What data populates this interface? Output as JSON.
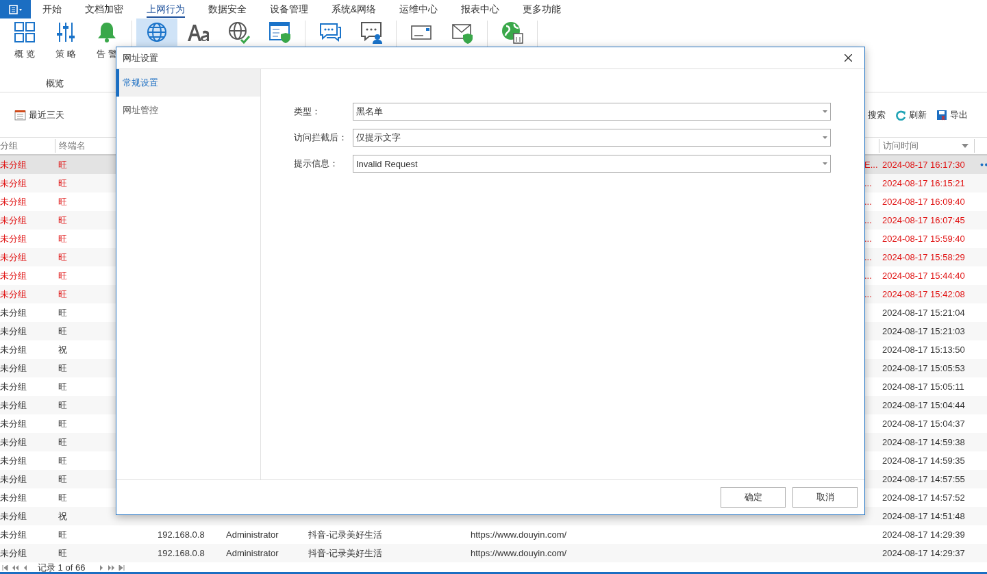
{
  "menu": {
    "tabs": [
      {
        "label": "开始",
        "selected": false
      },
      {
        "label": "文档加密",
        "selected": false
      },
      {
        "label": "上网行为",
        "selected": true
      },
      {
        "label": "数据安全",
        "selected": false
      },
      {
        "label": "设备管理",
        "selected": false
      },
      {
        "label": "系统&网络",
        "selected": false
      },
      {
        "label": "运维中心",
        "selected": false
      },
      {
        "label": "报表中心",
        "selected": false
      },
      {
        "label": "更多功能",
        "selected": false
      }
    ]
  },
  "ribbon": {
    "group_label": "概览",
    "buttons": [
      {
        "kind": "grid",
        "label": "概 览",
        "selected": false
      },
      {
        "kind": "sliders",
        "label": "策 略",
        "selected": false
      },
      {
        "kind": "bell",
        "label": "告 警",
        "selected": false
      },
      {
        "kind": "globe",
        "selected": true
      },
      {
        "kind": "font",
        "selected": false
      },
      {
        "kind": "globe-check",
        "selected": false
      },
      {
        "kind": "browser-shield",
        "selected": false
      },
      {
        "kind": "chat",
        "selected": false
      },
      {
        "kind": "chat-user",
        "selected": false
      },
      {
        "kind": "envelope",
        "selected": false
      },
      {
        "kind": "envelope-shield",
        "selected": false
      },
      {
        "kind": "globe-doc",
        "selected": false
      }
    ]
  },
  "toolbar": {
    "date_range": "最近三天",
    "actions": [
      {
        "kind": "search",
        "label": "搜索"
      },
      {
        "kind": "refresh",
        "label": "刷新"
      },
      {
        "kind": "export",
        "label": "导出"
      }
    ]
  },
  "table": {
    "columns": {
      "group": "分组",
      "terminal": "终端名",
      "time": "访问时间"
    },
    "rows": [
      {
        "group": "未分组",
        "terminal": "旺",
        "column_7": "E...",
        "time": "2024-08-17 16:17:30",
        "flagged": true,
        "selected": true
      },
      {
        "group": "未分组",
        "terminal": "旺",
        "column_7": "...",
        "time": "2024-08-17 16:15:21",
        "flagged": true,
        "selected": false
      },
      {
        "group": "未分组",
        "terminal": "旺",
        "column_7": "...",
        "time": "2024-08-17 16:09:40",
        "flagged": true,
        "selected": false
      },
      {
        "group": "未分组",
        "terminal": "旺",
        "column_7": "...",
        "time": "2024-08-17 16:07:45",
        "flagged": true,
        "selected": false
      },
      {
        "group": "未分组",
        "terminal": "旺",
        "column_7": "...",
        "time": "2024-08-17 15:59:40",
        "flagged": true,
        "selected": false
      },
      {
        "group": "未分组",
        "terminal": "旺",
        "column_7": "...",
        "time": "2024-08-17 15:58:29",
        "flagged": true,
        "selected": false
      },
      {
        "group": "未分组",
        "terminal": "旺",
        "column_7": "...",
        "time": "2024-08-17 15:44:40",
        "flagged": true,
        "selected": false
      },
      {
        "group": "未分组",
        "terminal": "旺",
        "column_7": "...",
        "time": "2024-08-17 15:42:08",
        "flagged": true,
        "selected": false
      },
      {
        "group": "未分组",
        "terminal": "旺",
        "time": "2024-08-17 15:21:04",
        "flagged": false,
        "selected": false
      },
      {
        "group": "未分组",
        "terminal": "旺",
        "time": "2024-08-17 15:21:03",
        "flagged": false,
        "selected": false
      },
      {
        "group": "未分组",
        "terminal": "祝",
        "time": "2024-08-17 15:13:50",
        "flagged": false,
        "selected": false
      },
      {
        "group": "未分组",
        "terminal": "旺",
        "time": "2024-08-17 15:05:53",
        "flagged": false,
        "selected": false
      },
      {
        "group": "未分组",
        "terminal": "旺",
        "time": "2024-08-17 15:05:11",
        "flagged": false,
        "selected": false
      },
      {
        "group": "未分组",
        "terminal": "旺",
        "time": "2024-08-17 15:04:44",
        "flagged": false,
        "selected": false
      },
      {
        "group": "未分组",
        "terminal": "旺",
        "time": "2024-08-17 15:04:37",
        "flagged": false,
        "selected": false
      },
      {
        "group": "未分组",
        "terminal": "旺",
        "time": "2024-08-17 14:59:38",
        "flagged": false,
        "selected": false
      },
      {
        "group": "未分组",
        "terminal": "旺",
        "time": "2024-08-17 14:59:35",
        "flagged": false,
        "selected": false
      },
      {
        "group": "未分组",
        "terminal": "旺",
        "time": "2024-08-17 14:57:55",
        "flagged": false,
        "selected": false
      },
      {
        "group": "未分组",
        "terminal": "旺",
        "time": "2024-08-17 14:57:52",
        "flagged": false,
        "selected": false
      },
      {
        "group": "未分组",
        "terminal": "祝",
        "time": "2024-08-17 14:51:48",
        "flagged": false,
        "selected": false
      },
      {
        "group": "未分组",
        "terminal": "旺",
        "column_3": "192.168.0.8",
        "column_4": "Administrator",
        "column_5": "抖音-记录美好生活",
        "column_6": "https://www.douyin.com/",
        "time": "2024-08-17 14:29:39",
        "flagged": false,
        "selected": false
      },
      {
        "group": "未分组",
        "terminal": "旺",
        "column_3": "192.168.0.8",
        "column_4": "Administrator",
        "column_5": "抖音-记录美好生活",
        "column_6": "https://www.douyin.com/",
        "time": "2024-08-17 14:29:37",
        "flagged": false,
        "selected": false
      }
    ]
  },
  "pager": {
    "text": "记录 1 of 66"
  },
  "dialog": {
    "title": "网址设置",
    "nav": [
      {
        "label": "常规设置",
        "selected": true
      },
      {
        "label": "网址管控",
        "selected": false
      }
    ],
    "fields": [
      {
        "label": "类型：",
        "value": "黑名单"
      },
      {
        "label": "访问拦截后：",
        "value": "仅提示文字"
      },
      {
        "label": "提示信息：",
        "value": "Invalid Request"
      }
    ],
    "buttons": [
      "确定",
      "取消"
    ]
  }
}
